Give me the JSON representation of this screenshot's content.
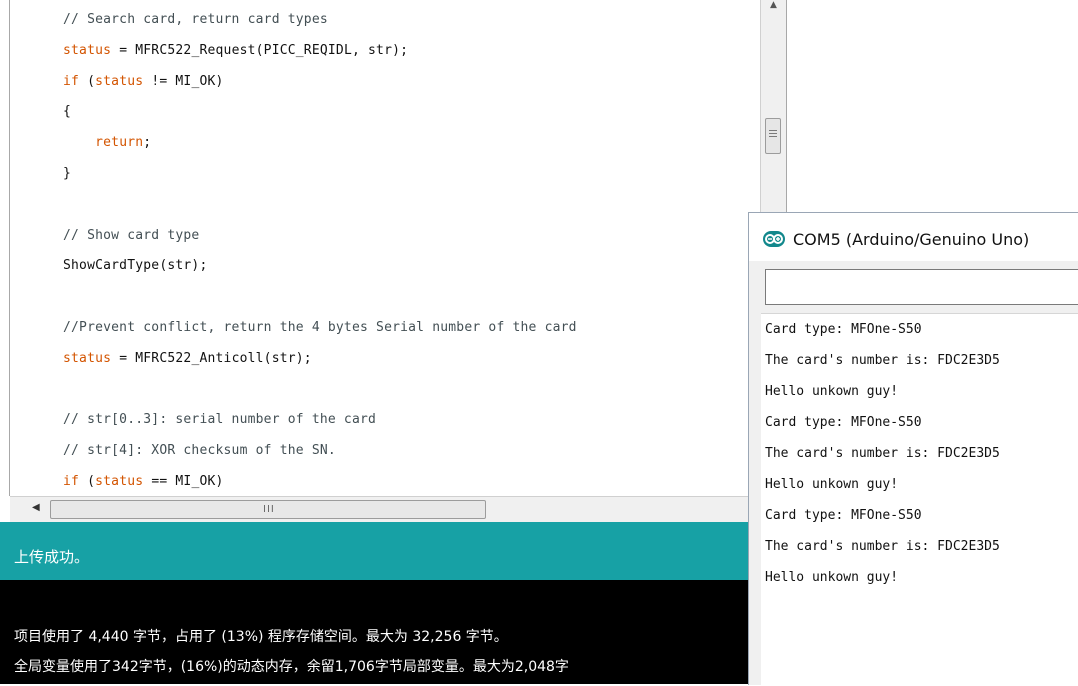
{
  "editor": {
    "lines": [
      {
        "parts": [
          {
            "t": "// Search card, return card types",
            "c": "cmt"
          }
        ]
      },
      {
        "parts": [
          {
            "t": "status",
            "c": "kw"
          },
          {
            "t": " = MFRC522_Request(PICC_REQIDL, str);",
            "c": "tx"
          }
        ]
      },
      {
        "parts": [
          {
            "t": "if",
            "c": "kw"
          },
          {
            "t": " (",
            "c": "tx"
          },
          {
            "t": "status",
            "c": "kw"
          },
          {
            "t": " != MI_OK)",
            "c": "tx"
          }
        ]
      },
      {
        "parts": [
          {
            "t": "{",
            "c": "tx"
          }
        ]
      },
      {
        "parts": [
          {
            "t": "    ",
            "c": "tx"
          },
          {
            "t": "return",
            "c": "kw"
          },
          {
            "t": ";",
            "c": "tx"
          }
        ]
      },
      {
        "parts": [
          {
            "t": "}",
            "c": "tx"
          }
        ]
      },
      {
        "parts": []
      },
      {
        "parts": [
          {
            "t": "// Show card type",
            "c": "cmt"
          }
        ]
      },
      {
        "parts": [
          {
            "t": "ShowCardType(str);",
            "c": "tx"
          }
        ]
      },
      {
        "parts": []
      },
      {
        "parts": [
          {
            "t": "//Prevent conflict, return the 4 bytes Serial number of the card",
            "c": "cmt"
          }
        ]
      },
      {
        "parts": [
          {
            "t": "status",
            "c": "kw"
          },
          {
            "t": " = MFRC522_Anticoll(str);",
            "c": "tx"
          }
        ]
      },
      {
        "parts": []
      },
      {
        "parts": [
          {
            "t": "// str[0..3]: serial number of the card",
            "c": "cmt"
          }
        ]
      },
      {
        "parts": [
          {
            "t": "// str[4]: XOR checksum of the SN.",
            "c": "cmt"
          }
        ]
      },
      {
        "parts": [
          {
            "t": "if",
            "c": "kw"
          },
          {
            "t": " (",
            "c": "tx"
          },
          {
            "t": "status",
            "c": "kw"
          },
          {
            "t": " == MI_OK)",
            "c": "tx"
          }
        ]
      }
    ]
  },
  "scrollbar": {
    "left_arrow": "◀",
    "up_arrow": "▲",
    "grip": "III"
  },
  "status_bar": {
    "message": "上传成功。"
  },
  "console": {
    "line1": "项目使用了 4,440 字节，占用了 (13%) 程序存储空间。最大为 32,256 字节。",
    "line2": "全局变量使用了342字节，(16%)的动态内存，余留1,706字节局部变量。最大为2,048字"
  },
  "serial_monitor": {
    "title": "COM5 (Arduino/Genuino Uno)",
    "input_value": "",
    "output_lines": [
      "Card type: MFOne-S50",
      "The card's number is: FDC2E3D5",
      "Hello unkown guy!",
      "Card type: MFOne-S50",
      "The card's number is: FDC2E3D5",
      "Hello unkown guy!",
      "Card type: MFOne-S50",
      "The card's number is: FDC2E3D5",
      "Hello unkown guy!"
    ]
  },
  "colors": {
    "status_bar": "#17a1a5",
    "console_bg": "#000000",
    "keyword": "#d35400",
    "comment": "#434f54"
  }
}
